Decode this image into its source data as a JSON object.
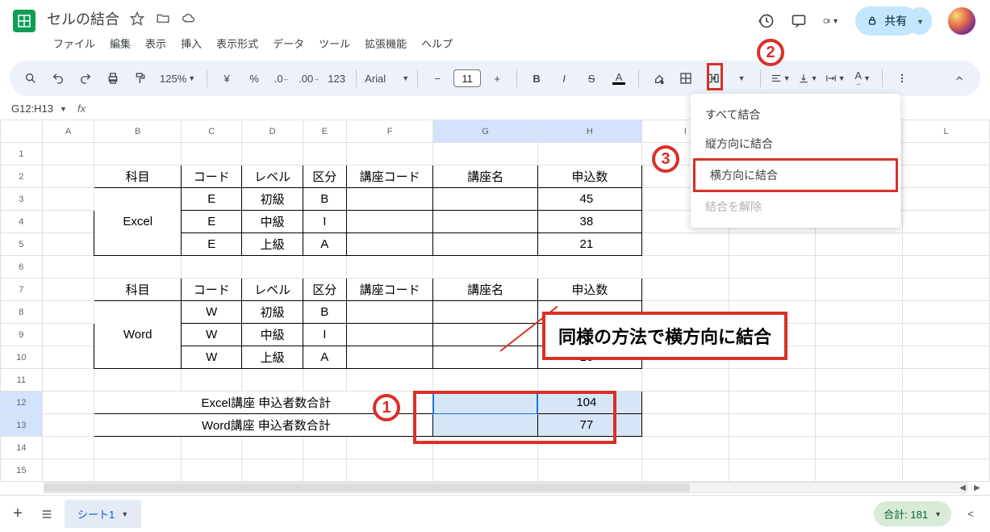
{
  "doc": {
    "title": "セルの結合"
  },
  "menubar": [
    "ファイル",
    "編集",
    "表示",
    "挿入",
    "表示形式",
    "データ",
    "ツール",
    "拡張機能",
    "ヘルプ"
  ],
  "toolbar": {
    "zoom": "125%",
    "font": "Arial",
    "fontsize": "11"
  },
  "share": {
    "label": "共有"
  },
  "namebox": "G12:H13",
  "columns": [
    "A",
    "B",
    "C",
    "D",
    "E",
    "F",
    "G",
    "H",
    "I",
    "J",
    "K",
    "L"
  ],
  "rows_shown": 15,
  "table1": {
    "headers": [
      "科目",
      "コード",
      "レベル",
      "区分",
      "講座コード",
      "講座名",
      "申込数"
    ],
    "subject": "Excel",
    "rows": [
      {
        "code": "E",
        "level": "初級",
        "kubun": "B",
        "count": "45"
      },
      {
        "code": "E",
        "level": "中級",
        "kubun": "I",
        "count": "38"
      },
      {
        "code": "E",
        "level": "上級",
        "kubun": "A",
        "count": "21"
      }
    ]
  },
  "table2": {
    "headers": [
      "科目",
      "コード",
      "レベル",
      "区分",
      "講座コード",
      "講座名",
      "申込数"
    ],
    "subject": "Word",
    "rows": [
      {
        "code": "W",
        "level": "初級",
        "kubun": "B",
        "count": ""
      },
      {
        "code": "W",
        "level": "中級",
        "kubun": "I",
        "count": ""
      },
      {
        "code": "W",
        "level": "上級",
        "kubun": "A",
        "count": "16"
      }
    ]
  },
  "totals": {
    "row12_label": "Excel講座 申込者数合計",
    "row12_val": "104",
    "row13_label": "Word講座 申込者数合計",
    "row13_val": "77"
  },
  "dropdown": {
    "items": [
      "すべて結合",
      "縦方向に結合",
      "横方向に結合",
      "結合を解除"
    ],
    "highlight_index": 2,
    "disabled_index": 3
  },
  "annotations": {
    "c1": "1",
    "c2": "2",
    "c3": "3",
    "text": "同様の方法で横方向に結合"
  },
  "footer": {
    "sheet": "シート1",
    "sum_label": "合計: 181"
  }
}
